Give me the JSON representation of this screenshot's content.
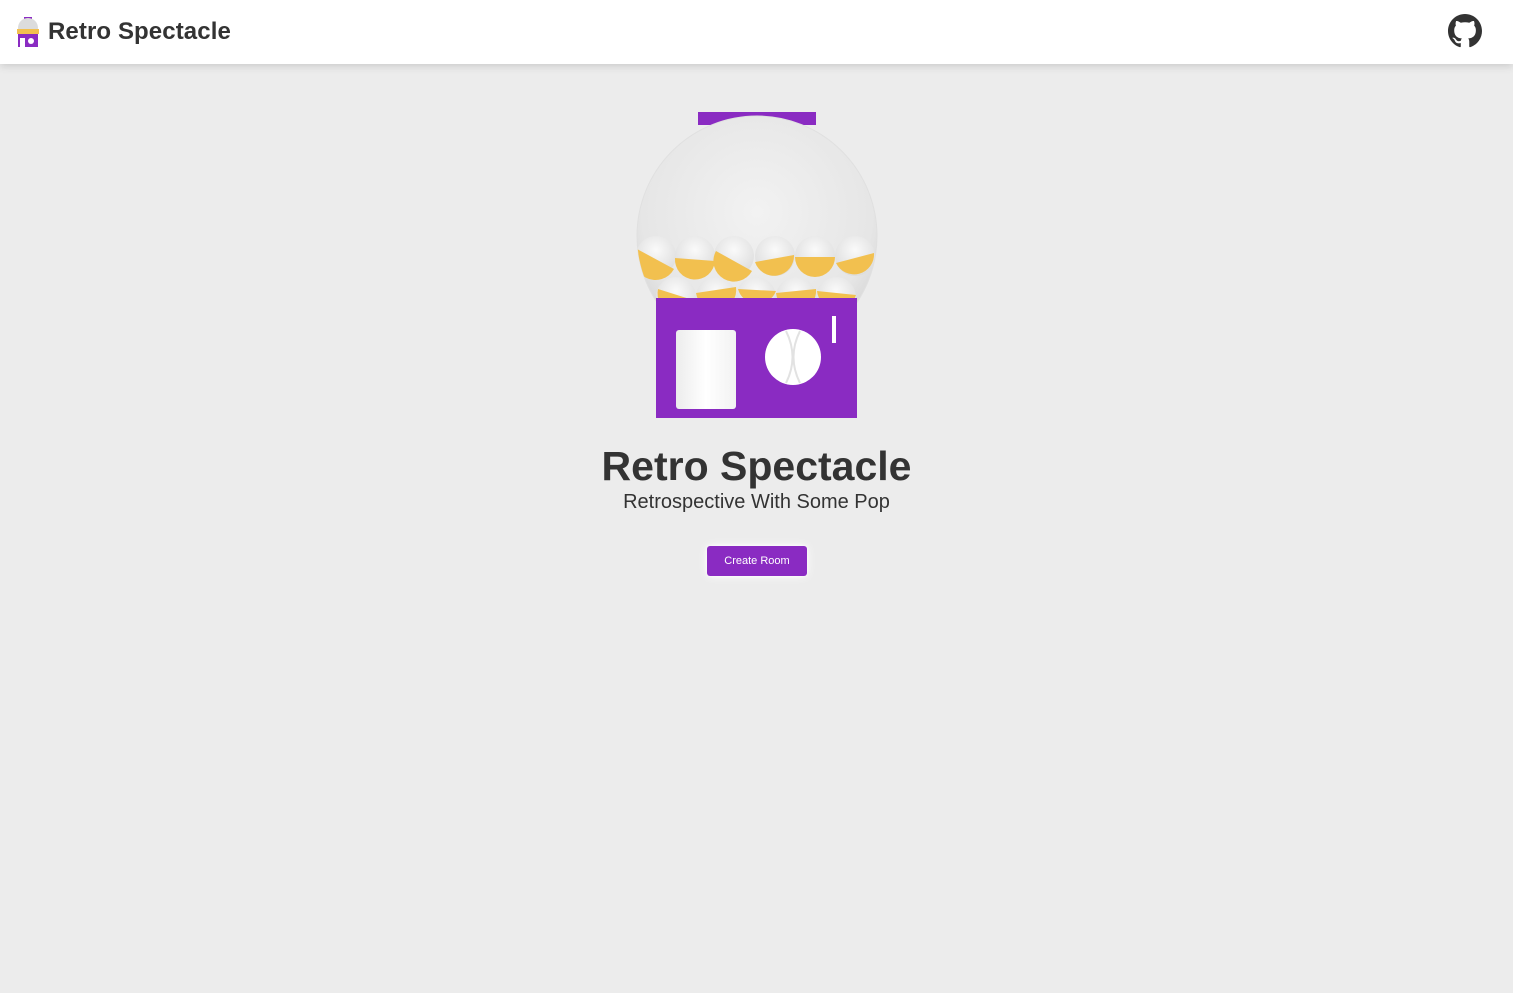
{
  "header": {
    "app_title": "Retro Spectacle",
    "logo_icon": "gumball-machine-icon",
    "github_icon": "github-icon"
  },
  "hero": {
    "title": "Retro Spectacle",
    "subtitle": "Retrospective With Some Pop",
    "illustration": "gumball-machine-illustration",
    "create_room_label": "Create Room"
  },
  "colors": {
    "brand_purple": "#8a2bc2",
    "gumball_yellow": "#f2c04f",
    "background": "#ececec",
    "header_background": "#ffffff",
    "text": "#333333"
  }
}
